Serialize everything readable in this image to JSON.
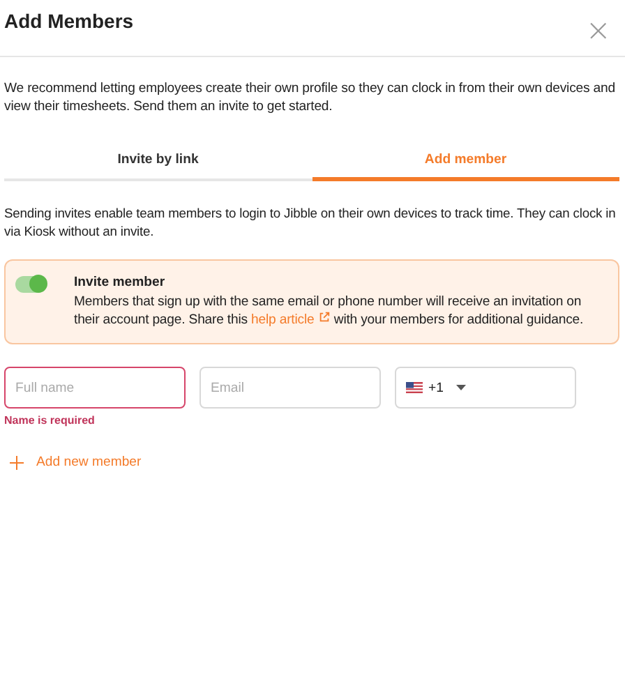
{
  "dialog": {
    "title": "Add Members",
    "close": "×"
  },
  "intro": "We recommend letting employees create their own profile so they can clock in from their own devices and view their timesheets. Send them an invite to get started.",
  "tabs": [
    {
      "label": "Invite by link",
      "selected": false
    },
    {
      "label": "Add member",
      "selected": true
    }
  ],
  "description": "Sending invites enable team members to login to Jibble on their own devices to track time. They can clock in via Kiosk without an invite.",
  "invite": {
    "on": true,
    "title": "Invite member",
    "text_before": "Members that sign up with the same email or phone number will receive an invitation on their account page. Share this",
    "link": "help article",
    "text_after": "with your members for additional guidance."
  },
  "fields": [
    {
      "kind": "text",
      "placeholder": "Full name",
      "invalid": true,
      "error": "Name is required"
    },
    {
      "kind": "text",
      "placeholder": "Email",
      "invalid": false
    },
    {
      "kind": "phone",
      "code": "+1",
      "invalid": false
    }
  ],
  "add_button": "Add new member"
}
